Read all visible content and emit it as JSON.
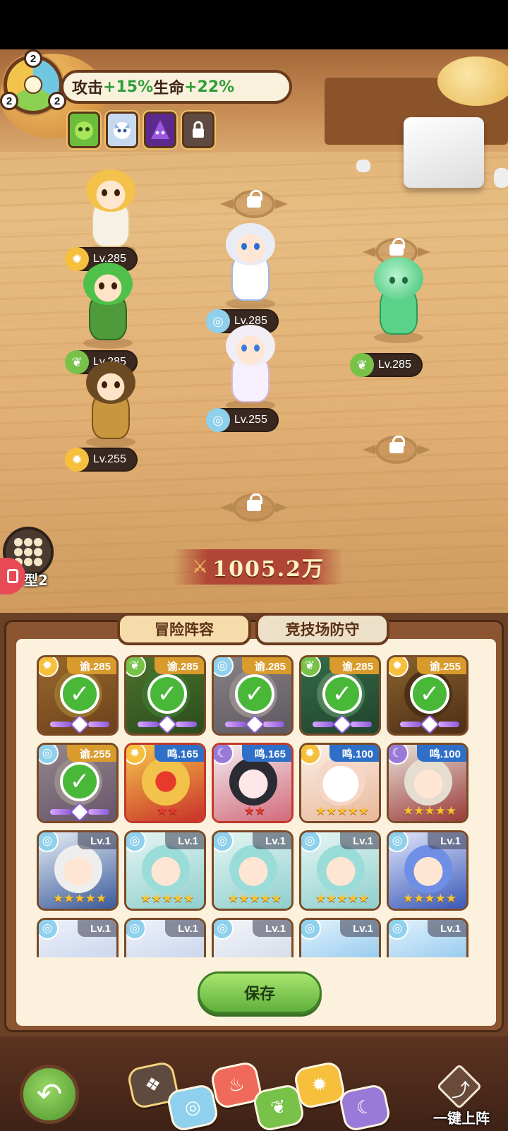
{
  "synergy": {
    "counts": [
      "2",
      "2",
      "2"
    ],
    "bonus_label_attack": "攻击",
    "bonus_value_attack": "+15%",
    "bonus_label_hp": "生命",
    "bonus_value_hp": "+22%",
    "slot_icons": [
      "green-slime-icon",
      "white-dragon-icon",
      "purple-hood-icon",
      "lock-icon"
    ]
  },
  "battlefield": {
    "heroes": [
      {
        "name": "maid-hero",
        "level": "Lv.285",
        "element": "sun"
      },
      {
        "name": "green-dragon-knight",
        "level": "Lv.285",
        "element": "leaf"
      },
      {
        "name": "golden-warrior",
        "level": "Lv.255",
        "element": "sun"
      },
      {
        "name": "bunny-girl",
        "level": "Lv.285",
        "element": "water"
      },
      {
        "name": "white-hair-mage",
        "level": "Lv.255",
        "element": "water"
      },
      {
        "name": "green-slime",
        "level": "Lv.285",
        "element": "leaf"
      }
    ],
    "formation_label": "型2",
    "power": "1005.2万"
  },
  "panel": {
    "tabs": [
      "冒险阵容",
      "竞技场防守"
    ],
    "cards": [
      {
        "level": "谕.285",
        "element": "sun",
        "selected": true
      },
      {
        "level": "谕.285",
        "element": "leaf",
        "selected": true
      },
      {
        "level": "谕.285",
        "element": "water",
        "selected": true
      },
      {
        "level": "谕.285",
        "element": "leaf",
        "selected": true
      },
      {
        "level": "谕.255",
        "element": "sun",
        "selected": true
      },
      {
        "level": "谕.255",
        "element": "water",
        "selected": true
      },
      {
        "level": "鸣.165",
        "element": "sun",
        "selected": false
      },
      {
        "level": "鸣.165",
        "element": "moon",
        "selected": false
      },
      {
        "level": "鸣.100",
        "element": "sun",
        "selected": false
      },
      {
        "level": "鸣.100",
        "element": "moon",
        "selected": false
      },
      {
        "level": "Lv.1",
        "element": "water",
        "selected": false
      },
      {
        "level": "Lv.1",
        "element": "water",
        "selected": false
      },
      {
        "level": "Lv.1",
        "element": "water",
        "selected": false
      },
      {
        "level": "Lv.1",
        "element": "water",
        "selected": false
      },
      {
        "level": "Lv.1",
        "element": "water",
        "selected": false
      },
      {
        "level": "Lv.1",
        "element": "water",
        "selected": false
      },
      {
        "level": "Lv.1",
        "element": "water",
        "selected": false
      },
      {
        "level": "Lv.1",
        "element": "water",
        "selected": false
      },
      {
        "level": "Lv.1",
        "element": "water",
        "selected": false
      },
      {
        "level": "Lv.1",
        "element": "water",
        "selected": false
      }
    ],
    "save_label": "保存"
  },
  "bottom": {
    "filters": [
      "all-element-icon",
      "water-icon",
      "fire-icon",
      "leaf-icon",
      "sun-icon",
      "moon-icon"
    ],
    "auto_deploy_label": "一键上阵"
  },
  "colors": {
    "accent_green": "#5fb03b",
    "wood_dark": "#6a3a1c",
    "level_pill": "#382820"
  }
}
